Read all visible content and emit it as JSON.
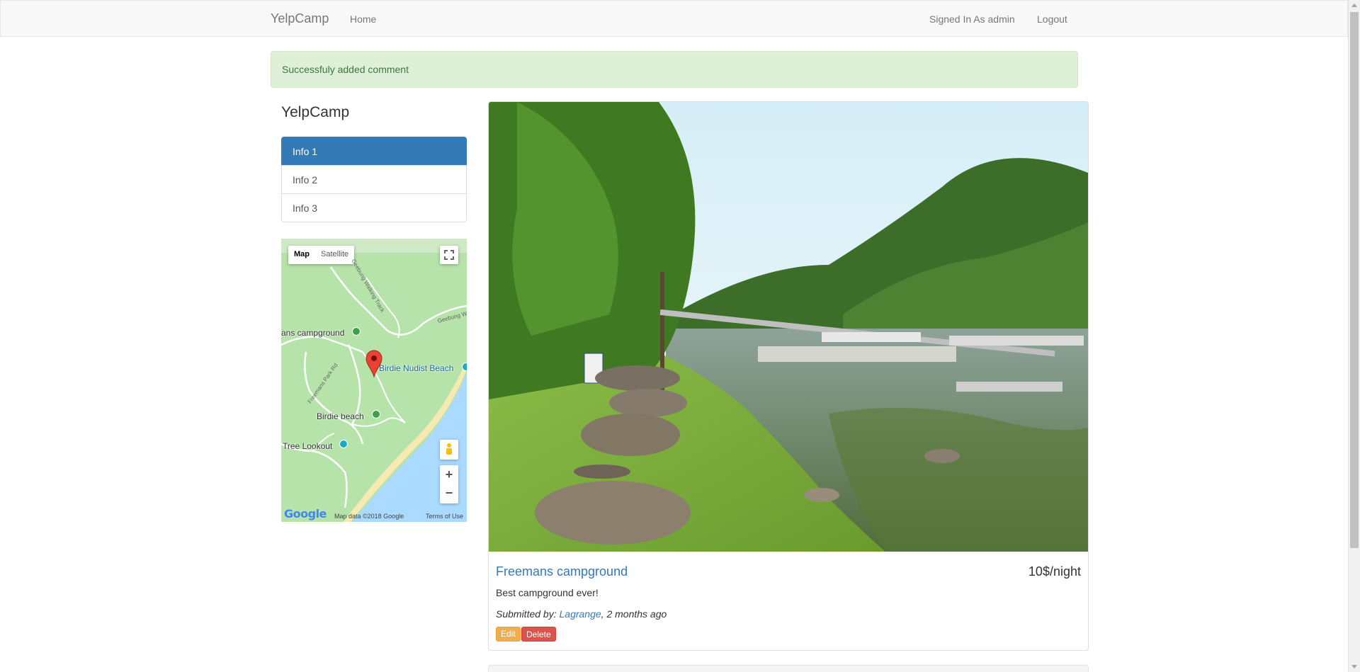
{
  "navbar": {
    "brand": "YelpCamp",
    "home": "Home",
    "signed_in": "Signed In As admin",
    "logout": "Logout"
  },
  "alert": {
    "message": "Successfuly added comment"
  },
  "sidebar": {
    "title": "YelpCamp",
    "items": [
      {
        "label": "Info 1"
      },
      {
        "label": "Info 2"
      },
      {
        "label": "Info 3"
      }
    ]
  },
  "map": {
    "type_map": "Map",
    "type_satellite": "Satellite",
    "labels": {
      "campground": "ans campground",
      "beach_nudist": "Birdie Nudist Beach",
      "beach": "Birdie beach",
      "lookout": "Tree Lookout",
      "road1": "Freemans Park Rd",
      "road2": "Geebung Walking Track",
      "road3": "Geebung Walki"
    },
    "logo": "Google",
    "data_text": "Map data ©2018 Google",
    "terms": "Terms of Use",
    "zoom_in": "+",
    "zoom_out": "−"
  },
  "campground": {
    "name": "Freemans campground",
    "price": "10$/night",
    "description": "Best campground ever!",
    "submitted_prefix": "Submitted by: ",
    "author": "Lagrange",
    "submitted_suffix": ", 2 months ago",
    "edit": "Edit",
    "delete": "Delete"
  }
}
